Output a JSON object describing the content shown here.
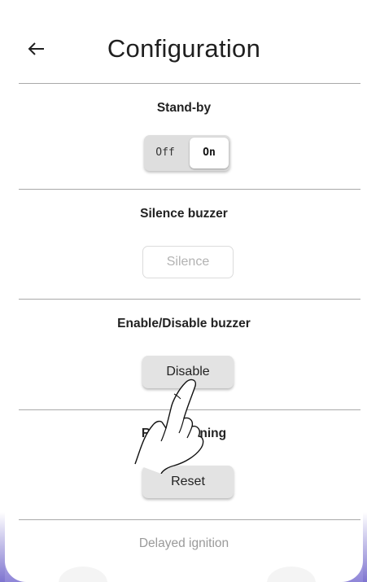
{
  "header": {
    "title": "Configuration",
    "back_icon": "arrow-left-icon"
  },
  "sections": {
    "standby": {
      "label": "Stand-by",
      "toggle_off": "Off",
      "toggle_on": "On",
      "selected": "On"
    },
    "silence": {
      "label": "Silence buzzer",
      "button": "Silence",
      "enabled": false
    },
    "buzzer": {
      "label": "Enable/Disable buzzer",
      "button": "Disable"
    },
    "reset": {
      "label": "Reset running",
      "button": "Reset"
    },
    "delayed": {
      "label": "Delayed ignition"
    }
  },
  "overlay": {
    "icon": "pointing-hand-icon"
  },
  "colors": {
    "accent_gradient": "#8f86d8",
    "divider": "#a9a9a9",
    "button_bg": "#e3e3e3"
  }
}
